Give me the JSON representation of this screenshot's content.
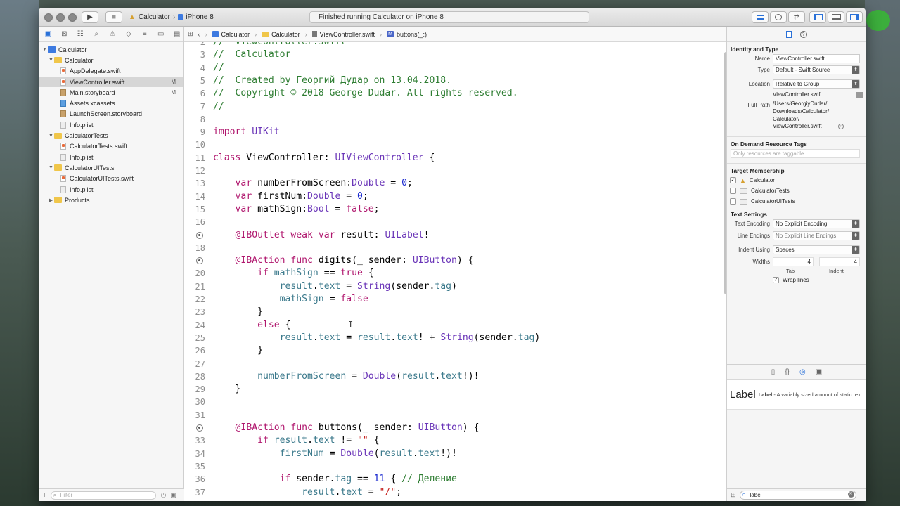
{
  "titlebar": {
    "scheme_target": "Calculator",
    "device": "iPhone 8",
    "status": "Finished running Calculator on iPhone 8",
    "run_icon": "play-icon",
    "stop_icon": "stop-icon"
  },
  "navigator": {
    "items": [
      {
        "label": "Calculator",
        "kind": "project",
        "depth": 0,
        "expanded": true
      },
      {
        "label": "Calculator",
        "kind": "folder",
        "depth": 1,
        "expanded": true
      },
      {
        "label": "AppDelegate.swift",
        "kind": "swift",
        "depth": 2
      },
      {
        "label": "ViewController.swift",
        "kind": "swift",
        "depth": 2,
        "selected": true,
        "badge": "M"
      },
      {
        "label": "Main.storyboard",
        "kind": "storyboard",
        "depth": 2,
        "badge": "M"
      },
      {
        "label": "Assets.xcassets",
        "kind": "assets",
        "depth": 2
      },
      {
        "label": "LaunchScreen.storyboard",
        "kind": "storyboard",
        "depth": 2
      },
      {
        "label": "Info.plist",
        "kind": "plist",
        "depth": 2
      },
      {
        "label": "CalculatorTests",
        "kind": "folder",
        "depth": 1,
        "expanded": true
      },
      {
        "label": "CalculatorTests.swift",
        "kind": "swift",
        "depth": 2
      },
      {
        "label": "Info.plist",
        "kind": "plist",
        "depth": 2
      },
      {
        "label": "CalculatorUITests",
        "kind": "folder",
        "depth": 1,
        "expanded": true
      },
      {
        "label": "CalculatorUITests.swift",
        "kind": "swift",
        "depth": 2
      },
      {
        "label": "Info.plist",
        "kind": "plist",
        "depth": 2
      },
      {
        "label": "Products",
        "kind": "folder",
        "depth": 1,
        "expanded": false
      }
    ],
    "filter_placeholder": "Filter"
  },
  "jumpbar": {
    "crumbs": [
      "Calculator",
      "Calculator",
      "ViewController.swift",
      "buttons(_:)"
    ]
  },
  "editor": {
    "lines": [
      {
        "n": "2",
        "text": "//  ViewController.swift"
      },
      {
        "n": "3",
        "text": "//  Calculator"
      },
      {
        "n": "4",
        "text": "//"
      },
      {
        "n": "5",
        "text": "//  Created by Георгий Дудар on 13.04.2018."
      },
      {
        "n": "6",
        "text": "//  Copyright © 2018 George Dudar. All rights reserved."
      },
      {
        "n": "7",
        "text": "//"
      },
      {
        "n": "8",
        "text": ""
      },
      {
        "n": "9",
        "text": "import UIKit"
      },
      {
        "n": "10",
        "text": ""
      },
      {
        "n": "11",
        "text": "class ViewController: UIViewController {"
      },
      {
        "n": "12",
        "text": ""
      },
      {
        "n": "13",
        "text": "    var numberFromScreen:Double = 0;"
      },
      {
        "n": "14",
        "text": "    var firstNum:Double = 0;"
      },
      {
        "n": "15",
        "text": "    var mathSign:Bool = false;"
      },
      {
        "n": "16",
        "text": ""
      },
      {
        "n": "17",
        "text": "    @IBOutlet weak var result: UILabel!",
        "connected": true
      },
      {
        "n": "18",
        "text": ""
      },
      {
        "n": "19",
        "text": "    @IBAction func digits(_ sender: UIButton) {",
        "connected": true
      },
      {
        "n": "20",
        "text": "        if mathSign == true {"
      },
      {
        "n": "21",
        "text": "            result.text = String(sender.tag)"
      },
      {
        "n": "22",
        "text": "            mathSign = false"
      },
      {
        "n": "23",
        "text": "        }"
      },
      {
        "n": "24",
        "text": "        else {"
      },
      {
        "n": "25",
        "text": "            result.text = result.text! + String(sender.tag)"
      },
      {
        "n": "26",
        "text": "        }"
      },
      {
        "n": "27",
        "text": ""
      },
      {
        "n": "28",
        "text": "        numberFromScreen = Double(result.text!)!"
      },
      {
        "n": "29",
        "text": "    }"
      },
      {
        "n": "30",
        "text": ""
      },
      {
        "n": "31",
        "text": ""
      },
      {
        "n": "32",
        "text": "    @IBAction func buttons(_ sender: UIButton) {",
        "connected": true
      },
      {
        "n": "33",
        "text": "        if result.text != \"\" {"
      },
      {
        "n": "34",
        "text": "            firstNum = Double(result.text!)!"
      },
      {
        "n": "35",
        "text": ""
      },
      {
        "n": "36",
        "text": "            if sender.tag == 11 { // Деление"
      },
      {
        "n": "37",
        "text": "                result.text = \"/\";"
      }
    ]
  },
  "inspector": {
    "identity_header": "Identity and Type",
    "name_label": "Name",
    "name_value": "ViewController.swift",
    "type_label": "Type",
    "type_value": "Default - Swift Source",
    "location_label": "Location",
    "location_value": "Relative to Group",
    "location_file": "ViewController.swift",
    "fullpath_label": "Full Path",
    "fullpath_lines": [
      "/Users/GeorgiyDudar/",
      "Downloads/Calculator/",
      "Calculator/",
      "ViewController.swift"
    ],
    "odr_header": "On Demand Resource Tags",
    "odr_placeholder": "Only resources are taggable",
    "tm_header": "Target Membership",
    "targets": [
      {
        "label": "Calculator",
        "checked": true
      },
      {
        "label": "CalculatorTests",
        "checked": false
      },
      {
        "label": "CalculatorUITests",
        "checked": false
      }
    ],
    "ts_header": "Text Settings",
    "encoding_label": "Text Encoding",
    "encoding_value": "No Explicit Encoding",
    "endings_label": "Line Endings",
    "endings_value": "No Explicit Line Endings",
    "indent_label": "Indent Using",
    "indent_value": "Spaces",
    "widths_label": "Widths",
    "tab_value": "4",
    "indent_width_value": "4",
    "tab_caption": "Tab",
    "indent_caption": "Indent",
    "wrap_label": "Wrap lines",
    "library_item_big": "Label",
    "library_item_title": "Label",
    "library_item_desc": " - A variably sized amount of static text.",
    "library_search_value": "label"
  },
  "colors": {
    "comment": "#2e7d32",
    "keyword": "#b0176e",
    "type": "#6a35b8",
    "number": "#1c2bd0",
    "property": "#3c7a8c",
    "string": "#c41a16"
  }
}
